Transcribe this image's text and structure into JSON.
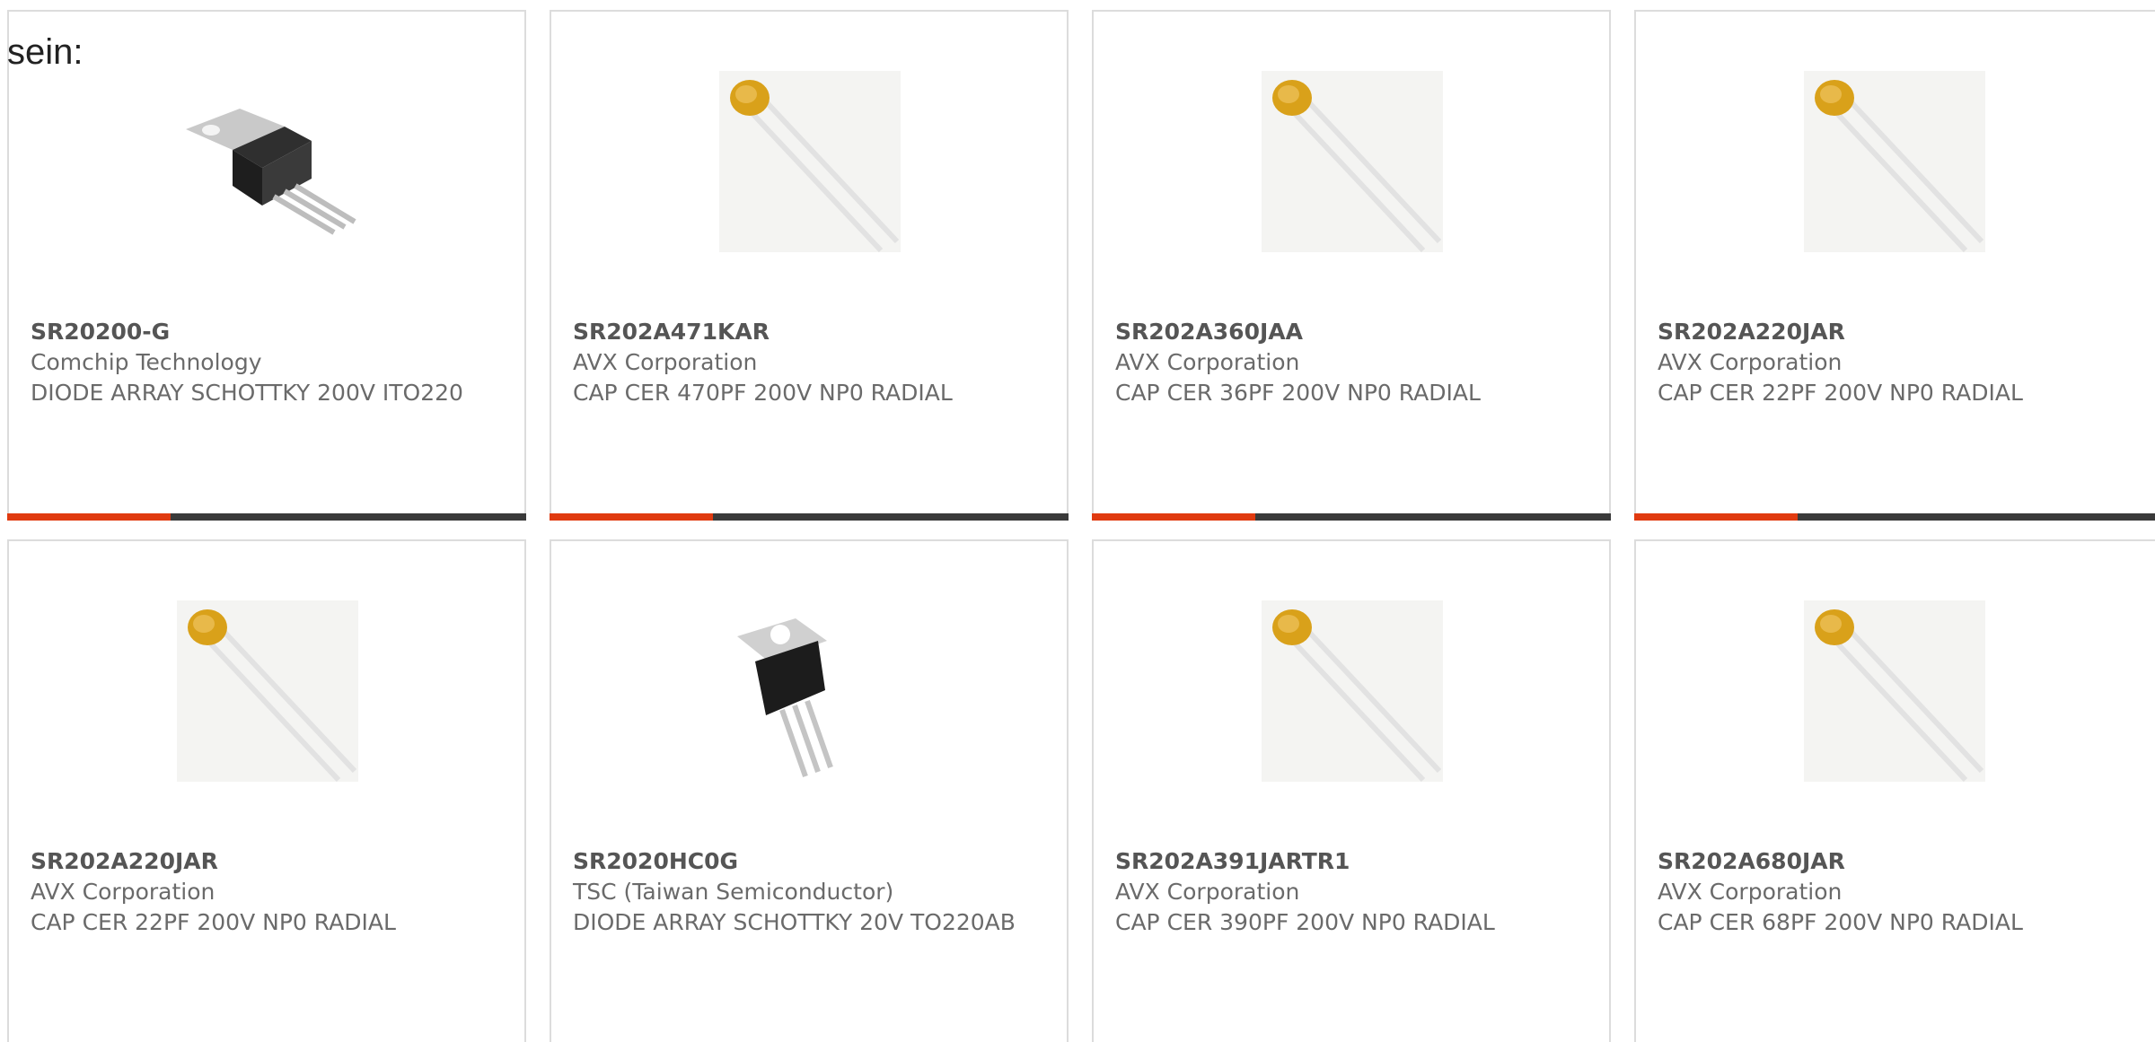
{
  "intro_text": "sein:",
  "accent_color": "#e03a10",
  "bar_color": "#3a3a3a",
  "products": [
    {
      "part": "SR20200-G",
      "maker": "Comchip Technology",
      "desc": "DIODE ARRAY SCHOTTKY 200V ITO220",
      "image": "to220-transistor"
    },
    {
      "part": "SR202A471KAR",
      "maker": "AVX Corporation",
      "desc": "CAP CER 470PF 200V NP0 RADIAL",
      "image": "ceramic-capacitor"
    },
    {
      "part": "SR202A360JAA",
      "maker": "AVX Corporation",
      "desc": "CAP CER 36PF 200V NP0 RADIAL",
      "image": "ceramic-capacitor"
    },
    {
      "part": "SR202A220JAR",
      "maker": "AVX Corporation",
      "desc": "CAP CER 22PF 200V NP0 RADIAL",
      "image": "ceramic-capacitor"
    },
    {
      "part": "SR202A220JAR",
      "maker": "AVX Corporation",
      "desc": "CAP CER 22PF 200V NP0 RADIAL",
      "image": "ceramic-capacitor"
    },
    {
      "part": "SR2020HC0G",
      "maker": "TSC (Taiwan Semiconductor)",
      "desc": "DIODE ARRAY SCHOTTKY 20V TO220AB",
      "image": "to220-transistor"
    },
    {
      "part": "SR202A391JARTR1",
      "maker": "AVX Corporation",
      "desc": "CAP CER 390PF 200V NP0 RADIAL",
      "image": "ceramic-capacitor"
    },
    {
      "part": "SR202A680JAR",
      "maker": "AVX Corporation",
      "desc": "CAP CER 68PF 200V NP0 RADIAL",
      "image": "ceramic-capacitor"
    }
  ]
}
